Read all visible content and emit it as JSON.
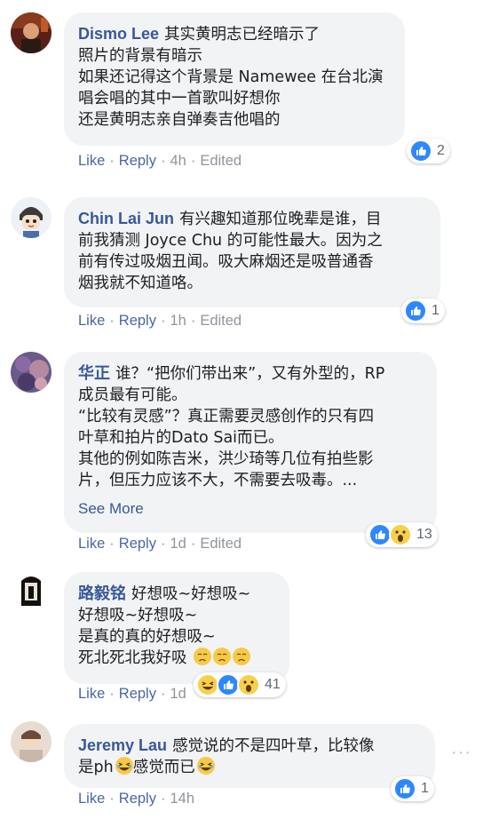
{
  "comments": [
    {
      "author": "Dismo Lee",
      "lines": [
        "其实黄明志已经暗示了",
        "照片的背景有暗示",
        "如果还记得这个背景是 Namewee 在台北演",
        "唱会唱的其中一首歌叫好想你",
        "还是黄明志亲自弹奏吉他唱的"
      ],
      "like": "Like",
      "reply": "Reply",
      "time": "4h",
      "edited": "Edited",
      "reaction_count": "2"
    },
    {
      "author": "Chin Lai Jun",
      "lines": [
        "有兴趣知道那位晚辈是谁，目",
        "前我猜测 Joyce Chu 的可能性最大。因为之",
        "前有传过吸烟丑闻。吸大麻烟还是吸普通香",
        "烟我就不知道咯。"
      ],
      "like": "Like",
      "reply": "Reply",
      "time": "1h",
      "edited": "Edited",
      "reaction_count": "1"
    },
    {
      "author": "华正",
      "lines": [
        "谁？“把你们带出来”，又有外型的，RP",
        "成员最有可能。",
        "“比较有灵感”？真正需要灵感创作的只有四",
        "叶草和拍片的Dato Sai而已。",
        "其他的例如陈吉米，洪少琦等几位有拍些影",
        "片，但压力应该不大，不需要去吸毒。..."
      ],
      "see_more": "See More",
      "like": "Like",
      "reply": "Reply",
      "time": "1d",
      "edited": "Edited",
      "reaction_count": "13"
    },
    {
      "author": "路毅铭",
      "lines": [
        "好想吸~好想吸~",
        "好想吸~好想吸~",
        "是真的真的好想吸~",
        "死北死北我好吸"
      ],
      "like": "Like",
      "reply": "Reply",
      "time": "1d",
      "reaction_count": "41"
    },
    {
      "author": "Jeremy Lau",
      "lines": [
        "感觉说的不是四叶草，比较像",
        "是ph"
      ],
      "line2_suffix": "感觉而已",
      "like": "Like",
      "reply": "Reply",
      "time": "14h",
      "reaction_count": "1"
    }
  ],
  "icons": {
    "like": "thumbs-up-icon",
    "wow": "wow-face-icon",
    "haha": "haha-face-icon",
    "sad": "sad-face-icon",
    "more": "more-dots-icon"
  },
  "colors": {
    "author": "#385898",
    "bubble": "#f2f3f5",
    "like_blue": "#2d88ff",
    "meta": "#90949c"
  }
}
